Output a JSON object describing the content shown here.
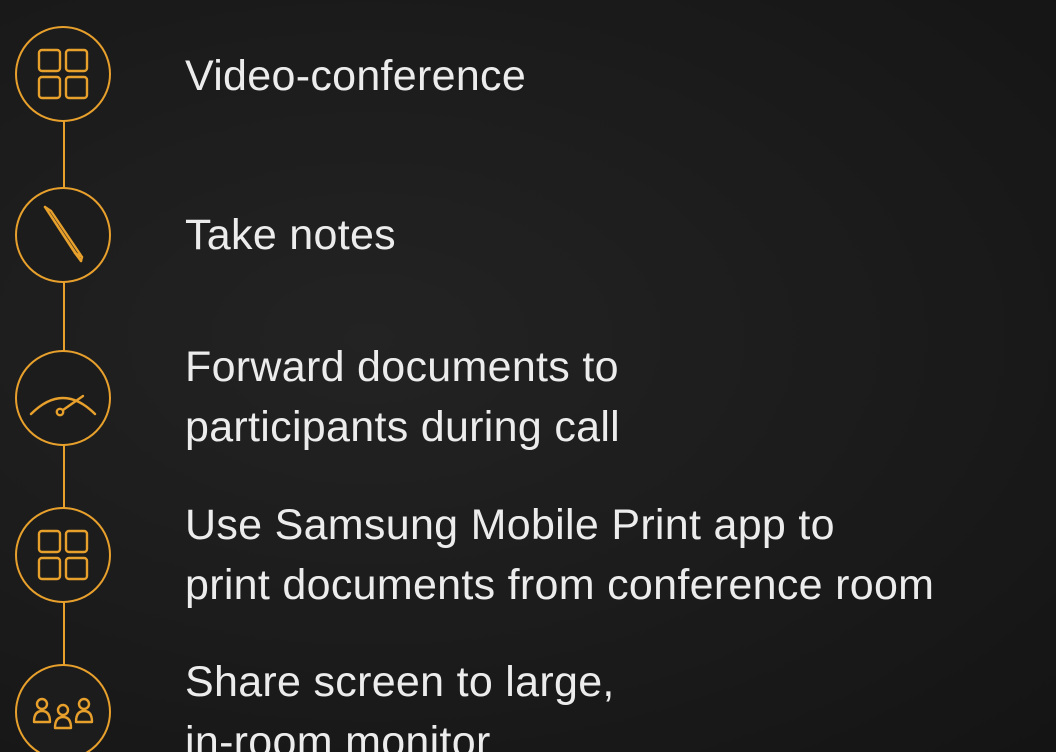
{
  "colors": {
    "accent": "#e8a02c",
    "text": "#ececec",
    "background": "#1c1c1c"
  },
  "steps": [
    {
      "icon": "grid-icon",
      "lines": [
        "Video-conference"
      ]
    },
    {
      "icon": "pen-icon",
      "lines": [
        "Take notes"
      ]
    },
    {
      "icon": "gauge-icon",
      "lines": [
        "Forward documents to",
        "participants during call"
      ]
    },
    {
      "icon": "grid-icon",
      "lines": [
        "Use Samsung Mobile Print app to",
        "print documents from conference room"
      ]
    },
    {
      "icon": "group-icon",
      "lines": [
        "Share screen to large,",
        "in-room monitor"
      ]
    }
  ]
}
